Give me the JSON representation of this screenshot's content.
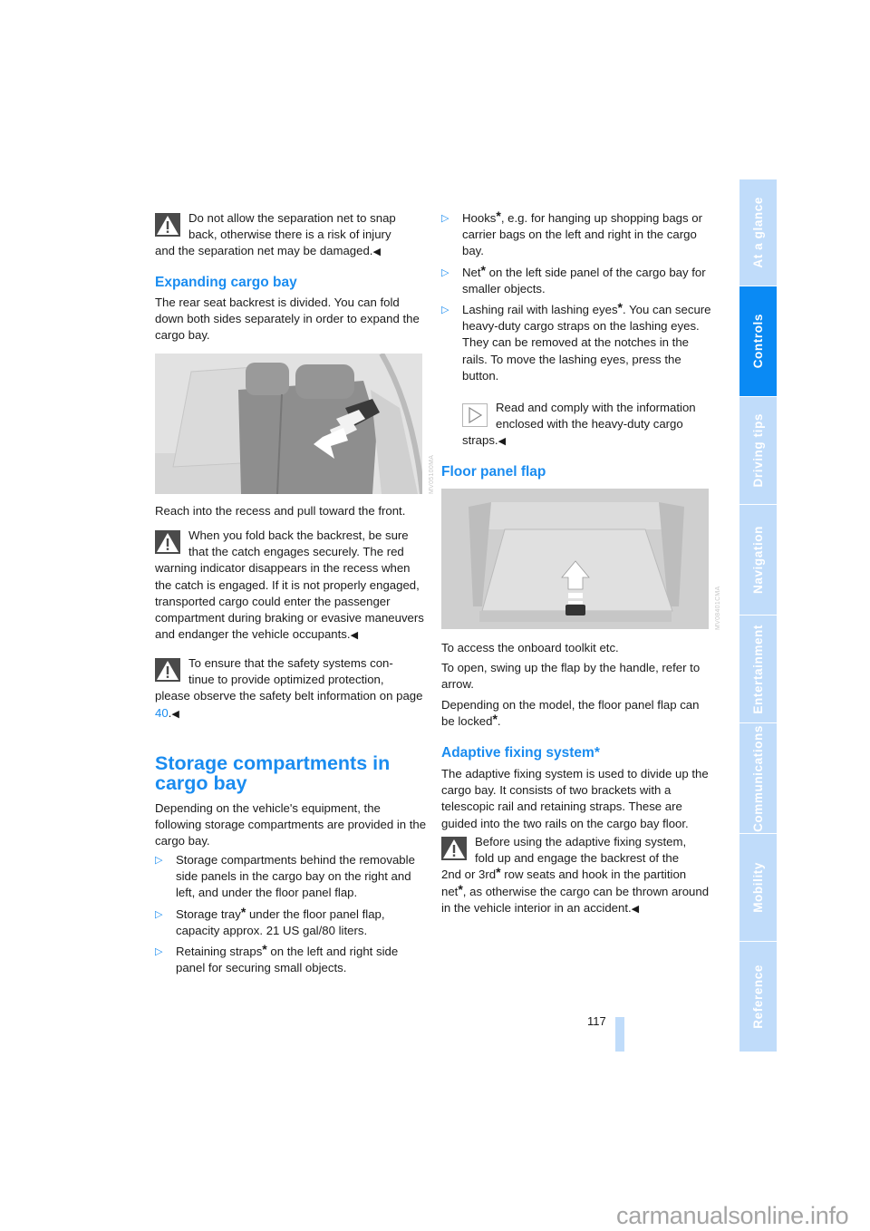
{
  "page": {
    "number": "117",
    "watermark": "carmanualsonline.info"
  },
  "side_tabs": [
    {
      "label": "At a glance",
      "active": false
    },
    {
      "label": "Controls",
      "active": true
    },
    {
      "label": "Driving tips",
      "active": false
    },
    {
      "label": "Navigation",
      "active": false
    },
    {
      "label": "Entertainment",
      "active": false
    },
    {
      "label": "Communications",
      "active": false
    },
    {
      "label": "Mobility",
      "active": false
    },
    {
      "label": "Reference",
      "active": false
    }
  ],
  "colors": {
    "accent": "#1a8cf0",
    "tab_inactive": "#c0dcfa",
    "tab_active": "#0a8af4"
  },
  "left": {
    "warn_net": {
      "line1": "Do not allow the separation net to snap",
      "line2": "back, otherwise there is a risk of injury",
      "rest": "and the separation net may be damaged.",
      "end_mark": "◀"
    },
    "expanding": {
      "heading": "Expanding cargo bay",
      "intro": "The rear seat backrest is divided. You can fold down both sides separately in order to expand the cargo bay.",
      "image_code": "MV05100MA",
      "caption": "Reach into the recess and pull toward the front."
    },
    "warn_backrest": {
      "line1": "When you fold back the backrest, be sure",
      "line2": "that the catch engages securely. The red",
      "rest": "warning indicator disappears in the recess when the catch is engaged. If it is not properly engaged, transported cargo could enter the passenger compartment during braking or evasive maneuvers and endanger the vehicle occupants.",
      "end_mark": "◀"
    },
    "warn_safety": {
      "line1": "To ensure that the safety systems con-",
      "line2": "tinue to provide optimized protection,",
      "rest": "please observe the safety belt information on page ",
      "page_link": "40",
      "suffix": ".",
      "end_mark": "◀"
    },
    "storage": {
      "heading_line1": "Storage compartments in",
      "heading_line2": "cargo bay",
      "intro": "Depending on the vehicle's equipment, the following storage compartments are provided in the cargo bay.",
      "bullet_marker": "▷",
      "items": [
        {
          "text": "Storage compartments behind the removable side panels in the cargo bay on the right and left, and under the floor panel flap."
        },
        {
          "pre": "Storage tray",
          "star": "*",
          "post": " under the floor panel flap, capacity approx. 21 US gal/80 liters."
        },
        {
          "pre": "Retaining straps",
          "star": "*",
          "post": " on the left and right side panel for securing small objects."
        }
      ]
    }
  },
  "right": {
    "items": [
      {
        "pre": "Hooks",
        "star": "*",
        "post": ", e.g. for hanging up shopping bags or carrier bags on the left and right in the cargo bay."
      },
      {
        "pre": "Net",
        "star": "*",
        "post": " on the left side panel of the cargo bay for smaller objects."
      },
      {
        "pre": "Lashing rail with lashing eyes",
        "star": "*",
        "post": ". You can secure heavy-duty cargo straps on the lashing eyes.",
        "extra": "They can be removed at the notches in the rails. To move the lashing eyes, press the button."
      }
    ],
    "note": {
      "line1": "Read and comply with the information",
      "line2": "enclosed with the heavy-duty cargo",
      "rest": "straps.",
      "end_mark": "◀"
    },
    "floor": {
      "heading": "Floor panel flap",
      "image_code": "MV08401CMA",
      "p1": "To access the onboard toolkit etc.",
      "p2": "To open, swing up the flap by the handle, refer to arrow.",
      "p3_pre": "Depending on the model, the floor panel flap can be locked",
      "p3_star": "*",
      "p3_post": "."
    },
    "adaptive": {
      "heading": "Adaptive fixing system*",
      "intro": "The adaptive fixing system is used to divide up the cargo bay. It consists of two brackets with a telescopic rail and retaining straps. These are guided into the two rails on the cargo bay floor.",
      "warn_line1": "Before using the adaptive fixing system,",
      "warn_line2": "fold up and engage the backrest of the",
      "warn_rest_a": "2nd or 3rd",
      "warn_star1": "*",
      "warn_rest_b": " row seats and hook in the partition net",
      "warn_star2": "*",
      "warn_rest_c": ", as otherwise the cargo can be thrown around in the vehicle interior in an accident.",
      "end_mark": "◀"
    }
  }
}
